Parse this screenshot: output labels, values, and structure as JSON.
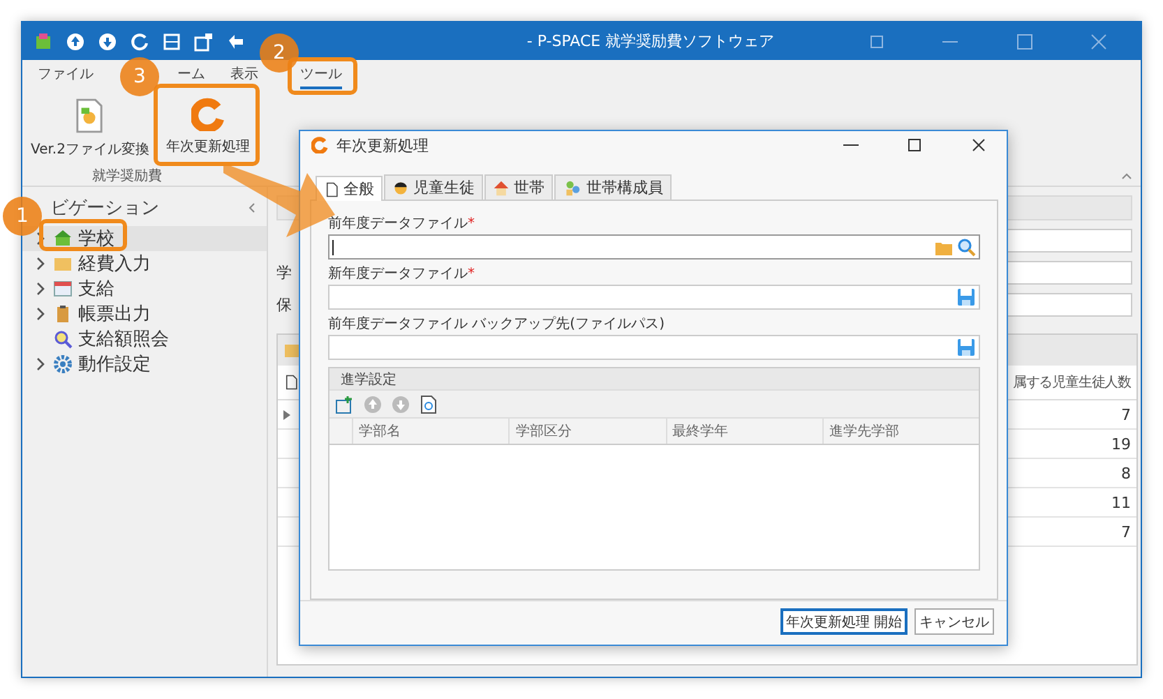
{
  "window": {
    "title": "- P-SPACE 就学奨励費ソフトウェア"
  },
  "menu": [
    {
      "label": "ファイル",
      "selected": false
    },
    {
      "label": "ーム",
      "selected": false
    },
    {
      "label": "表示",
      "selected": false
    },
    {
      "label": "ツール",
      "selected": true
    }
  ],
  "ribbon": {
    "buttons": [
      {
        "label": "Ver.2ファイル変換",
        "kind": "convert"
      },
      {
        "label": "年次更新処理",
        "kind": "update"
      }
    ],
    "group": "就学奨励費"
  },
  "navigation": {
    "title": "ビゲーション",
    "items": [
      {
        "label": "学校",
        "kind": "school",
        "expandable": true,
        "selected": true
      },
      {
        "label": "経費入力",
        "kind": "expense",
        "expandable": true,
        "selected": false
      },
      {
        "label": "支給",
        "kind": "calendar",
        "expandable": true,
        "selected": false
      },
      {
        "label": "帳票出力",
        "kind": "clipboard",
        "expandable": true,
        "selected": false
      },
      {
        "label": "支給額照会",
        "kind": "search",
        "expandable": false,
        "selected": false
      },
      {
        "label": "動作設定",
        "kind": "gear",
        "expandable": true,
        "selected": false
      }
    ]
  },
  "main": {
    "fields": [
      {
        "label": "学"
      },
      {
        "label": "保"
      }
    ],
    "table": {
      "column": "属する児童生徒人数",
      "rows": [
        "7",
        "19",
        "8",
        "11",
        "7"
      ]
    }
  },
  "dialog": {
    "title": "年次更新処理",
    "tabs": [
      {
        "label": "全般",
        "kind": "page",
        "selected": true
      },
      {
        "label": "児童生徒",
        "kind": "student",
        "selected": false
      },
      {
        "label": "世帯",
        "kind": "house",
        "selected": false
      },
      {
        "label": "世帯構成員",
        "kind": "members",
        "selected": false
      }
    ],
    "fields": [
      {
        "label": "前年度データファイル",
        "required_mark": "*",
        "focused": true,
        "kind": "browse"
      },
      {
        "label": "新年度データファイル",
        "required_mark": "*",
        "focused": false,
        "kind": "save"
      },
      {
        "label": "前年度データファイル バックアップ先(ファイルパス)",
        "focused": false,
        "kind": "save"
      }
    ],
    "group": {
      "title": "進学設定",
      "columns": [
        "学部名",
        "学部区分",
        "最終学年",
        "進学先学部"
      ]
    },
    "buttons": [
      {
        "label": "年次更新処理 開始",
        "default": true
      },
      {
        "label": "キャンセル",
        "default": false
      }
    ]
  },
  "callouts": [
    "1",
    "2",
    "3"
  ]
}
